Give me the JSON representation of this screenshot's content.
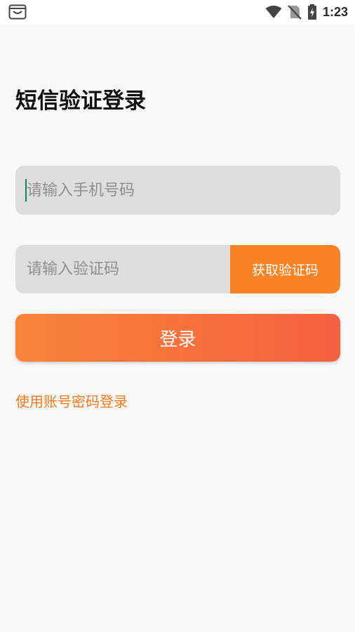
{
  "status_bar": {
    "time": "1:23",
    "left_icon": "notification-app-icon",
    "right_icons": [
      "wifi-icon",
      "no-sim-icon",
      "battery-charging-icon"
    ]
  },
  "page": {
    "title": "短信验证登录"
  },
  "phone_input": {
    "placeholder": "请输入手机号码",
    "value": ""
  },
  "code_input": {
    "placeholder": "请输入验证码",
    "value": ""
  },
  "buttons": {
    "get_code_label": "获取验证码",
    "login_label": "登录"
  },
  "links": {
    "account_login_label": "使用账号密码登录"
  },
  "colors": {
    "accent": "#f98324",
    "gradient_start": "#f9843a",
    "gradient_end": "#f5603f",
    "link": "#f4791f",
    "field_bg": "#dddddd",
    "page_bg": "#f8f8f8"
  }
}
